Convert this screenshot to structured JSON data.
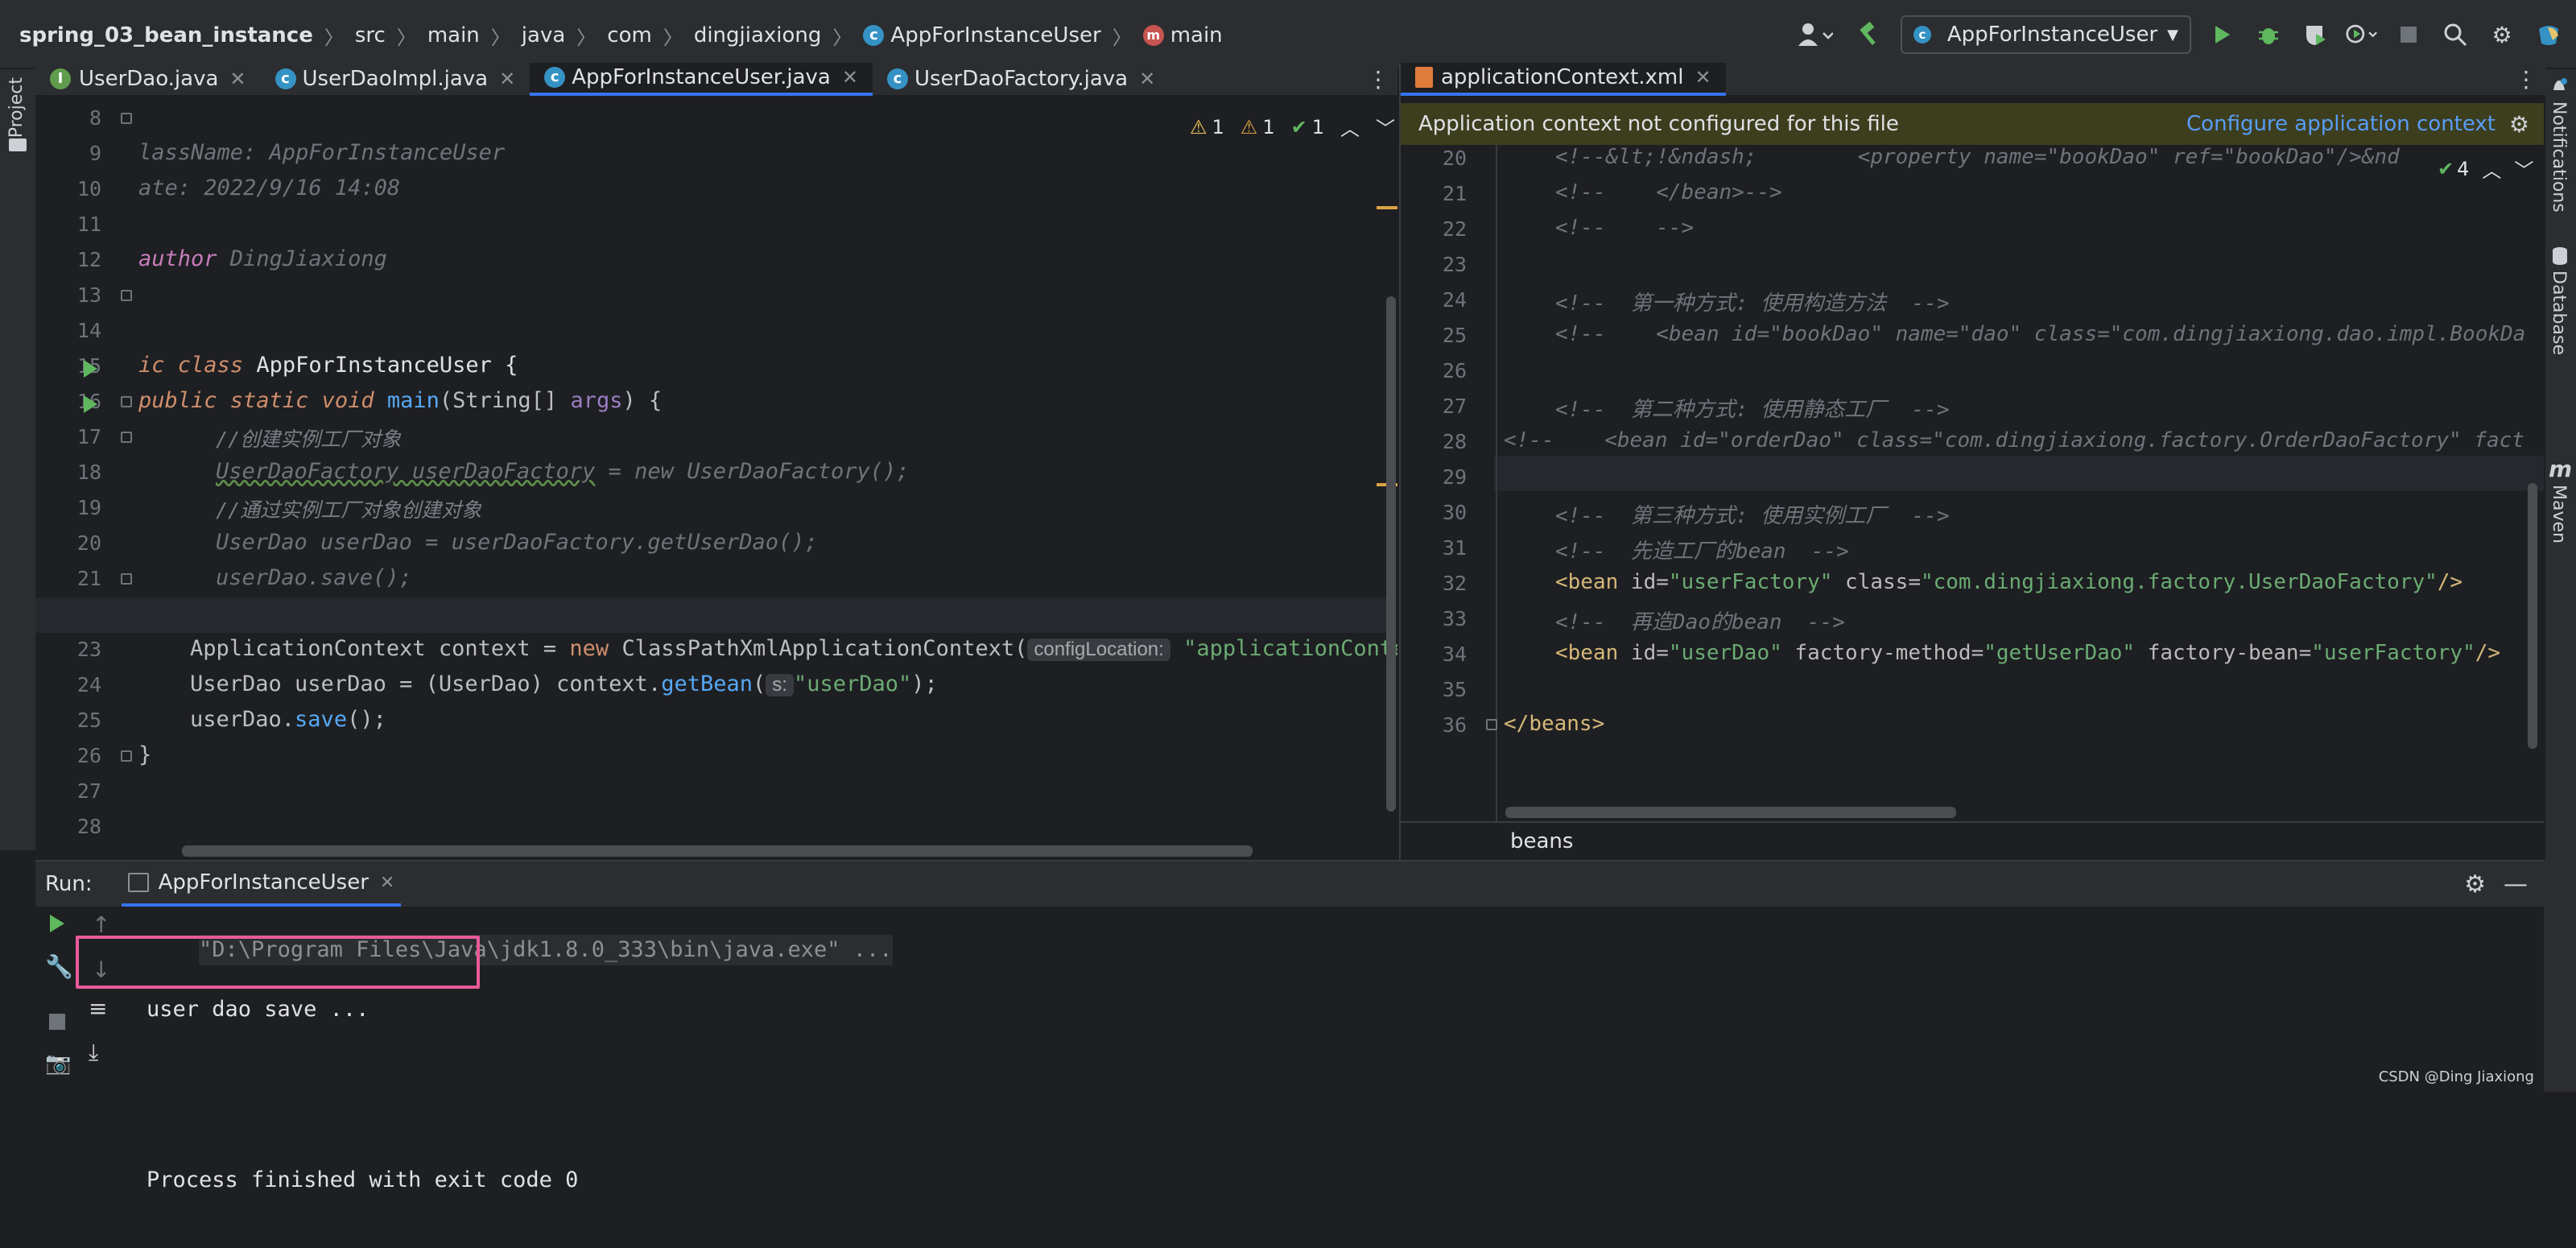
{
  "navbar": {
    "breadcrumbs": [
      "spring_03_bean_instance",
      "src",
      "main",
      "java",
      "com",
      "dingjiaxiong",
      "AppForInstanceUser",
      "main"
    ],
    "run_config": "AppForInstanceUser"
  },
  "left_strip": {
    "project_label": "Project"
  },
  "right_strip": {
    "notifications": "Notifications",
    "database": "Database",
    "maven": "Maven"
  },
  "left_editor": {
    "tabs": [
      {
        "label": "UserDao.java",
        "icon": "interface-icon"
      },
      {
        "label": "UserDaoImpl.java",
        "icon": "class-icon"
      },
      {
        "label": "AppForInstanceUser.java",
        "icon": "class-icon",
        "active": true
      },
      {
        "label": "UserDaoFactory.java",
        "icon": "class-icon"
      }
    ],
    "inspections": {
      "warnings_a": "1",
      "warnings_b": "1",
      "ok": "1"
    },
    "line_numbers": [
      "8",
      "9",
      "10",
      "11",
      "12",
      "13",
      "14",
      "15",
      "16",
      "17",
      "18",
      "19",
      "20",
      "21",
      "22",
      "23",
      "24",
      "25",
      "26",
      "27",
      "28"
    ],
    "lines": {
      "l9": "lassName: AppForInstanceUser",
      "l10": "ate: 2022/9/16 14:08",
      "l12a": "author",
      "l12b": " DingJiaxiong",
      "l15a": "ic class ",
      "l15b": "AppForInstanceUser {",
      "l16a": "public static void ",
      "l16b": "main",
      "l16c": "(String[] ",
      "l16d": "args",
      "l16e": ") {",
      "l17": "//创建实例工厂对象",
      "l18a": "UserDaoFactory userDaoFactory",
      "l18b": " = new UserDaoFactory();",
      "l19": "//通过实例工厂对象创建对象",
      "l20": "UserDao userDao = userDaoFactory.getUserDao();",
      "l21": "userDao.save();",
      "l23a": "ApplicationContext context = ",
      "l23b": "new ",
      "l23c": "ClassPathXmlApplicationContext(",
      "l23hint": "configLocation:",
      "l23d": "\"applicationConte",
      "l24a": "UserDao userDao = (UserDao) context.",
      "l24b": "getBean",
      "l24c": "(",
      "l24hint": "s:",
      "l24d": "\"userDao\"",
      "l24e": ");",
      "l25a": "userDao.",
      "l25b": "save",
      "l25c": "();",
      "l26": "}"
    }
  },
  "right_editor": {
    "tabs": [
      {
        "label": "applicationContext.xml",
        "icon": "xml-icon",
        "active": true
      }
    ],
    "banner": {
      "text": "Application context not configured for this file",
      "link": "Configure application context"
    },
    "inspections": {
      "ok": "4"
    },
    "line_numbers": [
      "20",
      "21",
      "22",
      "23",
      "24",
      "25",
      "26",
      "27",
      "28",
      "29",
      "30",
      "31",
      "32",
      "33",
      "34",
      "35",
      "36"
    ],
    "lines": {
      "l20": "<!--&lt;!&ndash;        <property name=\"bookDao\" ref=\"bookDao\"/>&nd",
      "l21": "<!--    </bean>-->",
      "l22": "<!--    -->",
      "l24": "<!--  第一种方式: 使用构造方法  -->",
      "l25": "<!--    <bean id=\"bookDao\" name=\"dao\" class=\"com.dingjiaxiong.dao.impl.BookDa",
      "l27": "<!--  第二种方式: 使用静态工厂  -->",
      "l28": "<!--    <bean id=\"orderDao\" class=\"com.dingjiaxiong.factory.OrderDaoFactory\" fact",
      "l30": "<!--  第三种方式: 使用实例工厂  -->",
      "l31": "<!--  先造工厂的bean  -->",
      "l32_tag": "<bean ",
      "l32_a1": "id=",
      "l32_v1": "\"userFactory\" ",
      "l32_a2": "class=",
      "l32_v2": "\"com.dingjiaxiong.factory.UserDaoFactory\"",
      "l32_end": "/>",
      "l33": "<!--  再造Dao的bean  -->",
      "l34_tag": "<bean ",
      "l34_a1": "id=",
      "l34_v1": "\"userDao\" ",
      "l34_a2": "factory-method=",
      "l34_v2": "\"getUserDao\" ",
      "l34_a3": "factory-bean=",
      "l34_v3": "\"userFactory\"",
      "l34_end": "/>",
      "l36a": "</",
      "l36b": "beans",
      "l36c": ">"
    },
    "breadcrumb": "beans"
  },
  "run_panel": {
    "label": "Run:",
    "tab": "AppForInstanceUser",
    "output": [
      "\"D:\\Program Files\\Java\\jdk1.8.0_333\\bin\\java.exe\" ...",
      "user dao save ...",
      "",
      "Process finished with exit code 0"
    ]
  },
  "watermark": "CSDN @Ding Jiaxiong",
  "colors": {
    "accent": "#3574f0",
    "highlight": "#e85a9a",
    "banner_bg": "#3d3e1e"
  }
}
